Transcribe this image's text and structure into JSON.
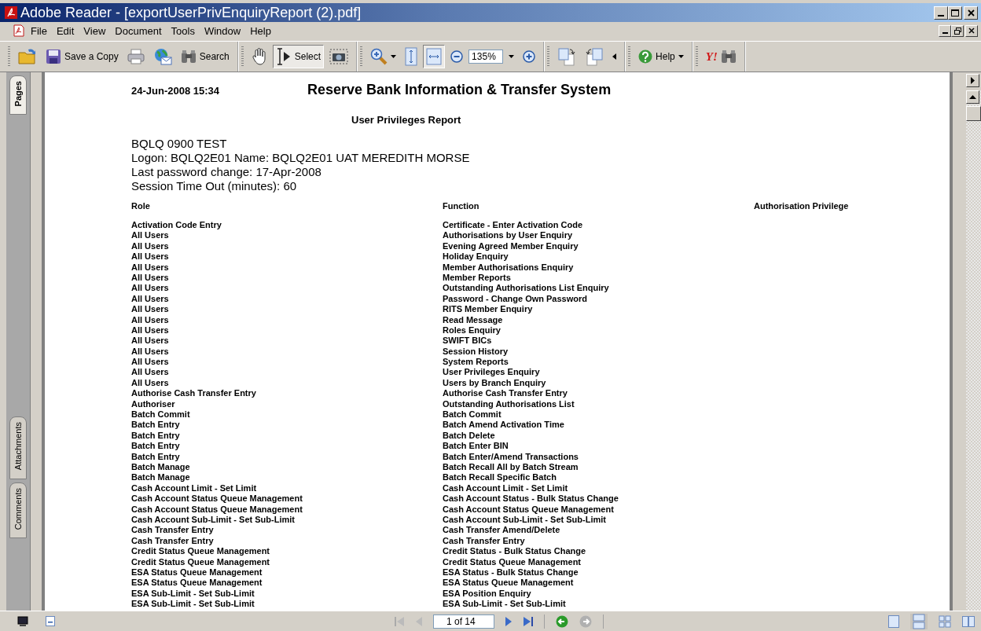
{
  "window": {
    "title": "Adobe Reader - [exportUserPrivEnquiryReport (2).pdf]"
  },
  "menu": [
    "File",
    "Edit",
    "View",
    "Document",
    "Tools",
    "Window",
    "Help"
  ],
  "toolbar": [
    [
      {
        "kind": "open"
      },
      {
        "kind": "save",
        "label": "Save a Copy"
      },
      {
        "kind": "print"
      },
      {
        "kind": "email"
      },
      {
        "kind": "search",
        "label": "Search"
      }
    ],
    [
      {
        "kind": "hand",
        "selected": false
      },
      {
        "kind": "select",
        "label": "Select",
        "selected": true
      },
      {
        "kind": "snapshot",
        "selected": false
      }
    ],
    [
      {
        "kind": "zoom-tool",
        "selected": false
      },
      {
        "kind": "fit-height",
        "selected": false
      },
      {
        "kind": "fit-width",
        "selected": true
      },
      {
        "kind": "zoom-out"
      },
      {
        "kind": "zoom-field",
        "value": "135%"
      },
      {
        "kind": "zoom-in"
      }
    ],
    [
      {
        "kind": "rotate-cw"
      },
      {
        "kind": "rotate-ccw"
      },
      {
        "kind": "more"
      }
    ],
    [
      {
        "kind": "help",
        "label": "Help"
      }
    ],
    [
      {
        "kind": "yahoo",
        "label": "Y!"
      }
    ]
  ],
  "side_tabs": [
    {
      "label": "Pages",
      "selected": true
    },
    {
      "label": "Attachments",
      "selected": false
    },
    {
      "label": "Comments",
      "selected": false
    }
  ],
  "report": {
    "timestamp": "24-Jun-2008 15:34",
    "title": "Reserve Bank Information & Transfer System",
    "subtitle": "User Privileges Report",
    "info": [
      "BQLQ 0900 TEST",
      "Logon: BQLQ2E01 Name: BQLQ2E01 UAT MEREDITH MORSE",
      "Last password change: 17-Apr-2008",
      "Session Time Out (minutes): 60"
    ],
    "columns": [
      "Role",
      "Function",
      "Authorisation Privilege"
    ],
    "rows": [
      {
        "role": "Activation Code Entry",
        "function": "Certificate - Enter Activation Code"
      },
      {
        "role": "All Users",
        "function": "Authorisations by User Enquiry"
      },
      {
        "role": "All Users",
        "function": "Evening Agreed Member Enquiry"
      },
      {
        "role": "All Users",
        "function": "Holiday Enquiry"
      },
      {
        "role": "All Users",
        "function": "Member Authorisations Enquiry"
      },
      {
        "role": "All Users",
        "function": "Member Reports"
      },
      {
        "role": "All Users",
        "function": "Outstanding Authorisations List Enquiry"
      },
      {
        "role": "All Users",
        "function": "Password - Change Own Password"
      },
      {
        "role": "All Users",
        "function": "RITS Member Enquiry"
      },
      {
        "role": "All Users",
        "function": "Read Message"
      },
      {
        "role": "All Users",
        "function": "Roles Enquiry"
      },
      {
        "role": "All Users",
        "function": "SWIFT BICs"
      },
      {
        "role": "All Users",
        "function": "Session History"
      },
      {
        "role": "All Users",
        "function": "System Reports"
      },
      {
        "role": "All Users",
        "function": "User Privileges Enquiry"
      },
      {
        "role": "All Users",
        "function": "Users by Branch Enquiry"
      },
      {
        "role": "Authorise Cash Transfer Entry",
        "function": "Authorise Cash Transfer Entry"
      },
      {
        "role": "Authoriser",
        "function": "Outstanding Authorisations List"
      },
      {
        "role": "Batch Commit",
        "function": "Batch Commit"
      },
      {
        "role": "Batch Entry",
        "function": "Batch Amend Activation Time"
      },
      {
        "role": "Batch Entry",
        "function": "Batch Delete"
      },
      {
        "role": "Batch Entry",
        "function": "Batch Enter BIN"
      },
      {
        "role": "Batch Entry",
        "function": "Batch Enter/Amend Transactions"
      },
      {
        "role": "Batch Manage",
        "function": "Batch Recall All by Batch Stream"
      },
      {
        "role": "Batch Manage",
        "function": "Batch Recall Specific Batch"
      },
      {
        "role": "Cash Account Limit - Set Limit",
        "function": "Cash Account Limit - Set Limit"
      },
      {
        "role": "Cash Account Status Queue Management",
        "function": "Cash Account Status - Bulk Status Change"
      },
      {
        "role": "Cash Account Status Queue Management",
        "function": "Cash Account Status Queue Management"
      },
      {
        "role": "Cash Account Sub-Limit - Set Sub-Limit",
        "function": "Cash Account Sub-Limit - Set Sub-Limit"
      },
      {
        "role": "Cash Transfer Entry",
        "function": "Cash Transfer Amend/Delete"
      },
      {
        "role": "Cash Transfer Entry",
        "function": "Cash Transfer Entry"
      },
      {
        "role": "Credit Status Queue Management",
        "function": "Credit Status - Bulk Status Change"
      },
      {
        "role": "Credit Status Queue Management",
        "function": "Credit Status Queue Management"
      },
      {
        "role": "ESA Status Queue Management",
        "function": "ESA Status - Bulk Status Change"
      },
      {
        "role": "ESA Status Queue Management",
        "function": "ESA Status Queue Management"
      },
      {
        "role": "ESA Sub-Limit - Set Sub-Limit",
        "function": "ESA Position Enquiry"
      },
      {
        "role": "ESA Sub-Limit - Set Sub-Limit",
        "function": "ESA Sub-Limit - Set Sub-Limit"
      }
    ]
  },
  "navigation": {
    "page_field": "1 of 14"
  }
}
